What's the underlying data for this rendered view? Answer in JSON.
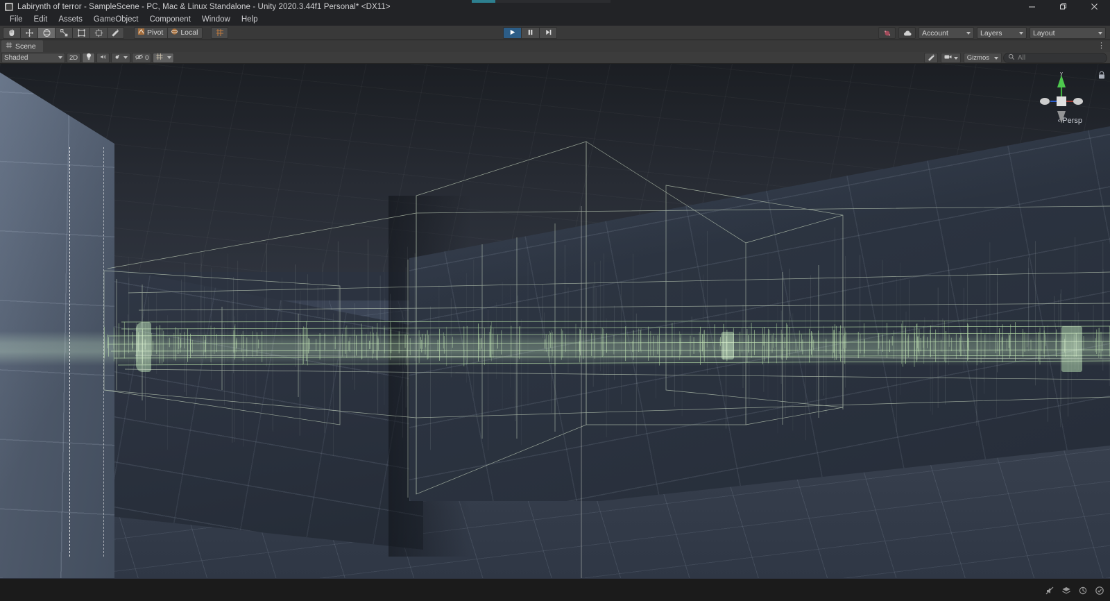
{
  "window": {
    "title": "Labirynth of terror - SampleScene - PC, Mac & Linux Standalone - Unity 2020.3.44f1 Personal* <DX11>",
    "app_icon": "unity-icon",
    "minimize_label": "—",
    "restore_label": "❐",
    "close_label": "✕"
  },
  "menubar": {
    "items": [
      {
        "label": "File"
      },
      {
        "label": "Edit"
      },
      {
        "label": "Assets"
      },
      {
        "label": "GameObject"
      },
      {
        "label": "Component"
      },
      {
        "label": "Window"
      },
      {
        "label": "Help"
      }
    ]
  },
  "toolbar": {
    "transform_tools": [
      {
        "name": "hand-tool",
        "icon": "hand-icon",
        "active": false
      },
      {
        "name": "move-tool",
        "icon": "move-icon",
        "active": false
      },
      {
        "name": "rotate-tool",
        "icon": "rotate-icon",
        "active": true
      },
      {
        "name": "scale-tool",
        "icon": "scale-icon",
        "active": false
      },
      {
        "name": "rect-tool",
        "icon": "rect-icon",
        "active": false
      },
      {
        "name": "transform-tool",
        "icon": "transform-icon",
        "active": false
      },
      {
        "name": "custom-tool",
        "icon": "wrench-icon",
        "active": false
      }
    ],
    "pivot_label": "Pivot",
    "pivot_icon": "pivot-icon",
    "local_label": "Local",
    "local_icon": "local-icon",
    "grid_snap_icon": "grid-snap-icon",
    "play_label": "play-icon",
    "pause_label": "pause-icon",
    "step_label": "step-icon",
    "play_active": true,
    "collab_icon": "collab-icon",
    "cloud_icon": "cloud-icon",
    "account_label": "Account",
    "layers_label": "Layers",
    "layout_label": "Layout"
  },
  "scene_panel": {
    "tab_label": "Scene",
    "tab_icon": "scene-icon",
    "menu_icon": "panel-menu-icon",
    "draw_mode": "Shaded",
    "two_d_label": "2D",
    "lighting_icon": "lightbulb-icon",
    "audio_icon": "audio-icon",
    "fx_icon": "fx-icon",
    "hidden_count": "0",
    "hidden_icon": "eye-off-icon",
    "grid_icon": "grid-icon",
    "tools_icon": "tools-icon",
    "camera_icon": "camera-icon",
    "gizmos_label": "Gizmos",
    "search_placeholder": "All",
    "search_value": "",
    "search_icon": "search-icon"
  },
  "viewport": {
    "projection_label": "Persp",
    "projection_icon": "persp-arrow-icon",
    "lock_icon": "lock-icon",
    "axis_y_color": "#4ec94e",
    "axis_x_color": "#c0392b",
    "axis_z_color": "#2d5fd0",
    "axis_center_color": "#d9d9d9",
    "gizmo_wire_color": "#c9d8c0",
    "collider_color": "#aed5a0",
    "selection_outline_color": "#ffffff",
    "scene_name": "Labirynth of terror"
  },
  "statusbar": {
    "message": "",
    "icons": [
      {
        "name": "mute-audio-icon"
      },
      {
        "name": "layers-status-icon"
      },
      {
        "name": "code-optimization-icon"
      },
      {
        "name": "status-ok-icon"
      }
    ]
  }
}
